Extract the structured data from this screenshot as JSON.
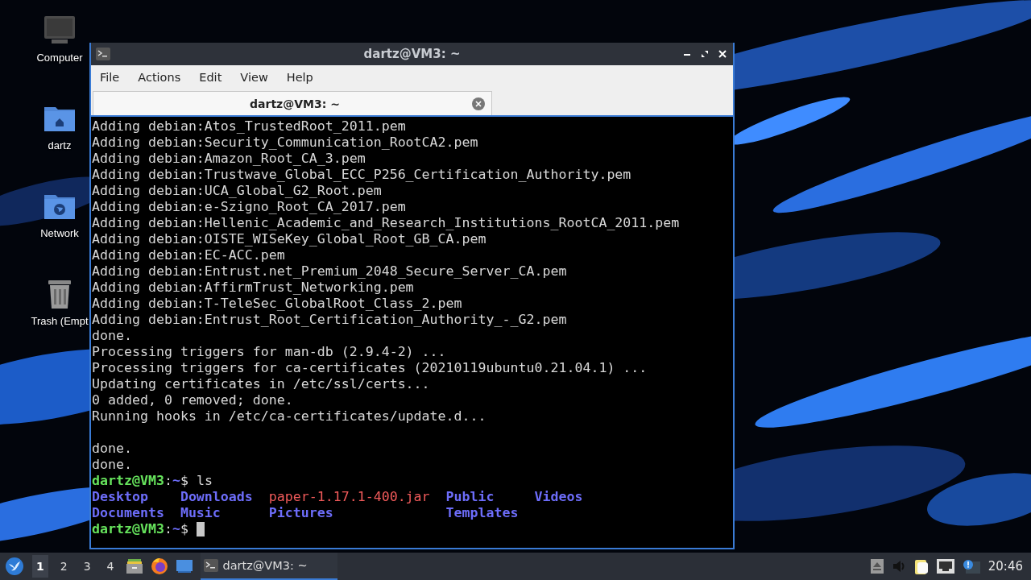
{
  "desktop_icons": [
    {
      "label": "Computer",
      "kind": "computer"
    },
    {
      "label": "dartz",
      "kind": "home"
    },
    {
      "label": "Network",
      "kind": "network"
    },
    {
      "label": "Trash (Empt",
      "kind": "trash"
    }
  ],
  "window": {
    "title": "dartz@VM3: ~",
    "menu": [
      "File",
      "Actions",
      "Edit",
      "View",
      "Help"
    ],
    "tabs": [
      {
        "label": "dartz@VM3: ~",
        "selected": true
      }
    ],
    "terminal": {
      "lines": [
        {
          "kind": "text",
          "text": "Adding debian:Atos_TrustedRoot_2011.pem"
        },
        {
          "kind": "text",
          "text": "Adding debian:Security_Communication_RootCA2.pem"
        },
        {
          "kind": "text",
          "text": "Adding debian:Amazon_Root_CA_3.pem"
        },
        {
          "kind": "text",
          "text": "Adding debian:Trustwave_Global_ECC_P256_Certification_Authority.pem"
        },
        {
          "kind": "text",
          "text": "Adding debian:UCA_Global_G2_Root.pem"
        },
        {
          "kind": "text",
          "text": "Adding debian:e-Szigno_Root_CA_2017.pem"
        },
        {
          "kind": "text",
          "text": "Adding debian:Hellenic_Academic_and_Research_Institutions_RootCA_2011.pem"
        },
        {
          "kind": "text",
          "text": "Adding debian:OISTE_WISeKey_Global_Root_GB_CA.pem"
        },
        {
          "kind": "text",
          "text": "Adding debian:EC-ACC.pem"
        },
        {
          "kind": "text",
          "text": "Adding debian:Entrust.net_Premium_2048_Secure_Server_CA.pem"
        },
        {
          "kind": "text",
          "text": "Adding debian:AffirmTrust_Networking.pem"
        },
        {
          "kind": "text",
          "text": "Adding debian:T-TeleSec_GlobalRoot_Class_2.pem"
        },
        {
          "kind": "text",
          "text": "Adding debian:Entrust_Root_Certification_Authority_-_G2.pem"
        },
        {
          "kind": "text",
          "text": "done."
        },
        {
          "kind": "text",
          "text": "Processing triggers for man-db (2.9.4-2) ..."
        },
        {
          "kind": "text",
          "text": "Processing triggers for ca-certificates (20210119ubuntu0.21.04.1) ..."
        },
        {
          "kind": "text",
          "text": "Updating certificates in /etc/ssl/certs..."
        },
        {
          "kind": "text",
          "text": "0 added, 0 removed; done."
        },
        {
          "kind": "text",
          "text": "Running hooks in /etc/ca-certificates/update.d..."
        },
        {
          "kind": "blank"
        },
        {
          "kind": "text",
          "text": "done."
        },
        {
          "kind": "text",
          "text": "done."
        },
        {
          "kind": "prompt",
          "user": "dartz@VM3",
          "sep": ":",
          "path": "~",
          "symbol": "$",
          "command": "ls"
        },
        {
          "kind": "ls",
          "rows": [
            [
              {
                "name": "Desktop",
                "kind": "dir"
              },
              {
                "name": "Downloads",
                "kind": "dir"
              },
              {
                "name": "paper-1.17.1-400.jar",
                "kind": "file"
              },
              {
                "name": "Public",
                "kind": "dir"
              },
              {
                "name": "Videos",
                "kind": "dir"
              }
            ],
            [
              {
                "name": "Documents",
                "kind": "dir"
              },
              {
                "name": "Music",
                "kind": "dir"
              },
              {
                "name": "Pictures",
                "kind": "dir"
              },
              {
                "name": "Templates",
                "kind": "dir"
              }
            ]
          ]
        },
        {
          "kind": "prompt",
          "user": "dartz@VM3",
          "sep": ":",
          "path": "~",
          "symbol": "$",
          "cursor": true
        }
      ]
    }
  },
  "taskbar": {
    "workspaces": [
      {
        "label": "1",
        "selected": true
      },
      {
        "label": "2",
        "selected": false
      },
      {
        "label": "3",
        "selected": false
      },
      {
        "label": "4",
        "selected": false
      }
    ],
    "tasks": [
      {
        "label": "dartz@VM3: ~",
        "selected": true
      }
    ],
    "clock": "20:46"
  }
}
